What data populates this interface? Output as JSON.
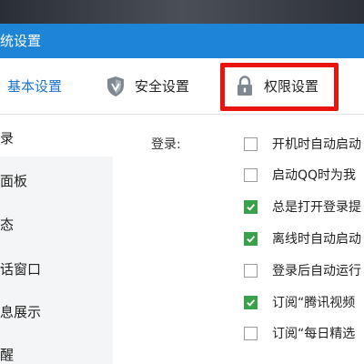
{
  "window": {
    "title": "统设置"
  },
  "tabs": [
    {
      "label": "基本设置",
      "active": true
    },
    {
      "label": "安全设置",
      "active": false
    },
    {
      "label": "权限设置",
      "active": false,
      "highlighted": true
    }
  ],
  "sidebar": {
    "items": [
      {
        "label": "录"
      },
      {
        "label": "面板"
      },
      {
        "label": "态"
      },
      {
        "label": "话窗口"
      },
      {
        "label": "息展示"
      },
      {
        "label": "醒"
      }
    ]
  },
  "login_section": {
    "label": "登录:",
    "options": [
      {
        "label": "开机时自动启动",
        "checked": false
      },
      {
        "label": "启动QQ时为我",
        "checked": false
      },
      {
        "label": "总是打开登录提",
        "checked": true
      },
      {
        "label": "离线时自动启动",
        "checked": true
      },
      {
        "label": "登录后自动运行",
        "checked": false
      },
      {
        "label": "订阅“腾讯视频",
        "checked": true
      },
      {
        "label": "订阅“每日精选",
        "checked": false
      }
    ]
  },
  "colors": {
    "titlebar": "#1e84d6",
    "active_tab": "#1e73c8",
    "highlight_box": "#e8140d",
    "checkbox_checked": "#3aa14a",
    "sidebar_bg": "#f4f5f6"
  },
  "icons": {
    "security_tab": "shield-icon",
    "permission_tab": "lock-icon",
    "checkbox_checked": "checkmark-icon"
  }
}
